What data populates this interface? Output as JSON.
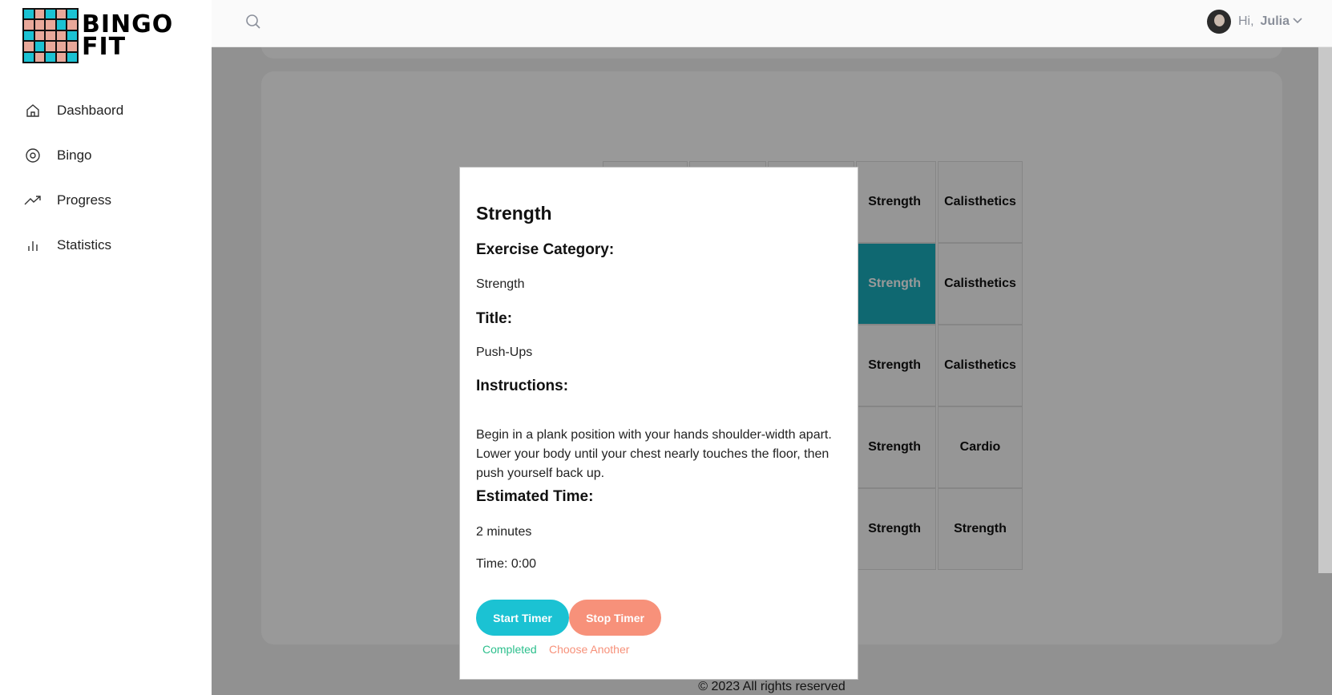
{
  "app": {
    "logo_line1": "BINGO",
    "logo_line2": "FIT"
  },
  "sidebar": {
    "items": [
      {
        "label": "Dashbaord",
        "icon": "home-icon"
      },
      {
        "label": "Bingo",
        "icon": "target-icon"
      },
      {
        "label": "Progress",
        "icon": "trending-up-icon"
      },
      {
        "label": "Statistics",
        "icon": "bar-chart-icon"
      }
    ]
  },
  "header": {
    "greeting": "Hi,",
    "user_name": "Julia"
  },
  "bingo": {
    "visible_cells": [
      {
        "row": 1,
        "col": 4,
        "text": "Strength",
        "active": false
      },
      {
        "row": 1,
        "col": 5,
        "text": "Calisthetics",
        "active": false
      },
      {
        "row": 2,
        "col": 4,
        "text": "Strength",
        "active": true
      },
      {
        "row": 2,
        "col": 5,
        "text": "Calisthetics",
        "active": false
      },
      {
        "row": 3,
        "col": 4,
        "text": "Strength",
        "active": false
      },
      {
        "row": 3,
        "col": 5,
        "text": "Calisthetics",
        "active": false
      },
      {
        "row": 4,
        "col": 4,
        "text": "Strength",
        "active": false
      },
      {
        "row": 4,
        "col": 5,
        "text": "Cardio",
        "active": false
      },
      {
        "row": 5,
        "col": 4,
        "text": "Strength",
        "active": false
      },
      {
        "row": 5,
        "col": 5,
        "text": "Strength",
        "active": false
      }
    ]
  },
  "footer": {
    "copyright": "© 2023 All rights reserved"
  },
  "modal": {
    "title": "Strength",
    "category_heading": "Exercise Category:",
    "category_value": "Strength",
    "title_heading": "Title:",
    "title_value": "Push-Ups",
    "instructions_heading": "Instructions:",
    "instructions_value": "Begin in a plank position with your hands shoulder-width apart. Lower your body until your chest nearly touches the floor, then push yourself back up.",
    "time_heading": "Estimated Time:",
    "time_value": "2 minutes",
    "timer_text": "Time: 0:00",
    "start_label": "Start Timer",
    "stop_label": "Stop Timer",
    "completed_label": "Completed",
    "choose_label": "Choose Another"
  },
  "colors": {
    "teal": "#1bc2d3",
    "active_cell": "#1aaebd",
    "salmon": "#f7917a",
    "completed_green": "#2bbf8c"
  }
}
